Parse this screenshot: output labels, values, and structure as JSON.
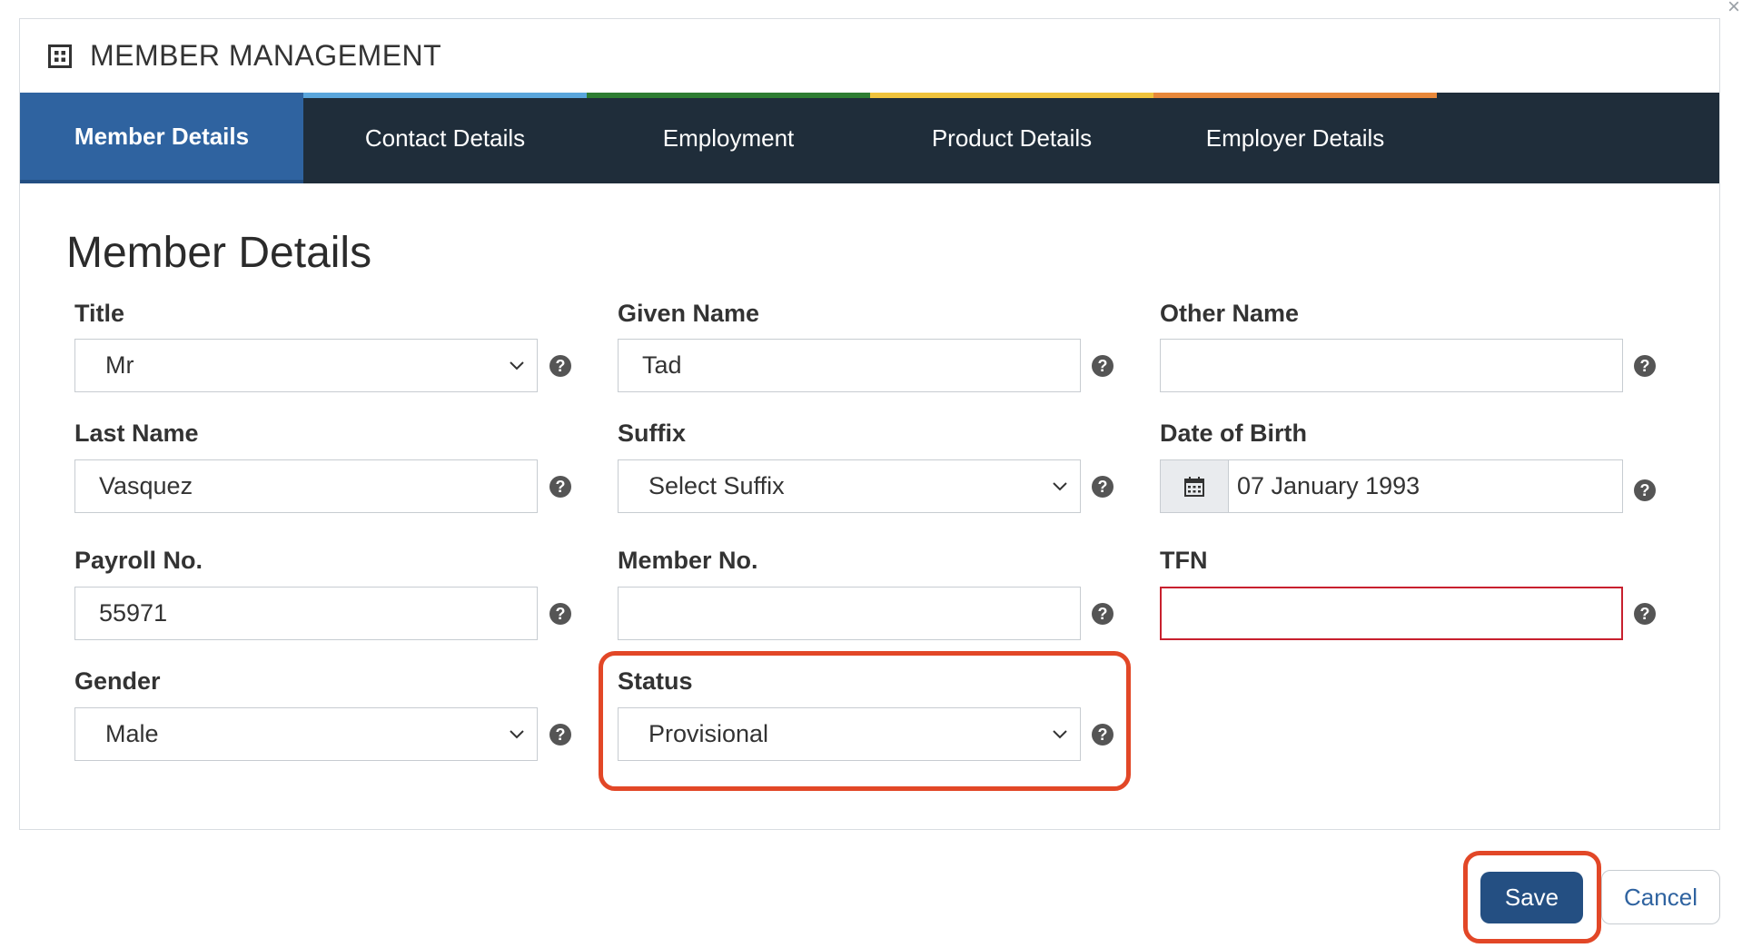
{
  "header": {
    "title": "MEMBER MANAGEMENT"
  },
  "tabs": [
    {
      "label": "Member Details",
      "stripe": "#2f63a0",
      "active": true
    },
    {
      "label": "Contact Details",
      "stripe": "#5aa6dc"
    },
    {
      "label": "Employment",
      "stripe": "#2e7d32"
    },
    {
      "label": "Product Details",
      "stripe": "#f0c33c"
    },
    {
      "label": "Employer Details",
      "stripe": "#e8883a"
    }
  ],
  "section_title": "Member Details",
  "fields": {
    "title": {
      "label": "Title",
      "value": "Mr"
    },
    "given_name": {
      "label": "Given Name",
      "value": "Tad"
    },
    "other_name": {
      "label": "Other Name",
      "value": ""
    },
    "last_name": {
      "label": "Last Name",
      "value": "Vasquez"
    },
    "suffix": {
      "label": "Suffix",
      "value": "Select Suffix"
    },
    "dob": {
      "label": "Date of Birth",
      "value": "07 January 1993"
    },
    "payroll": {
      "label": "Payroll No.",
      "value": "55971"
    },
    "member_no": {
      "label": "Member No.",
      "value": ""
    },
    "tfn": {
      "label": "TFN",
      "value": ""
    },
    "gender": {
      "label": "Gender",
      "value": "Male"
    },
    "status": {
      "label": "Status",
      "value": "Provisional"
    }
  },
  "help_glyph": "?",
  "close_glyph": "×",
  "buttons": {
    "save": "Save",
    "cancel": "Cancel"
  },
  "colors": {
    "tab_bar": "#1f2d3a",
    "active_tab": "#2f63a0",
    "primary": "#244f82",
    "error": "#c8202e",
    "highlight": "#e24727"
  },
  "icons": {
    "header": "grid-icon",
    "dropdown": "chevron-down-icon",
    "help": "question-circle-icon",
    "date": "calendar-icon"
  }
}
